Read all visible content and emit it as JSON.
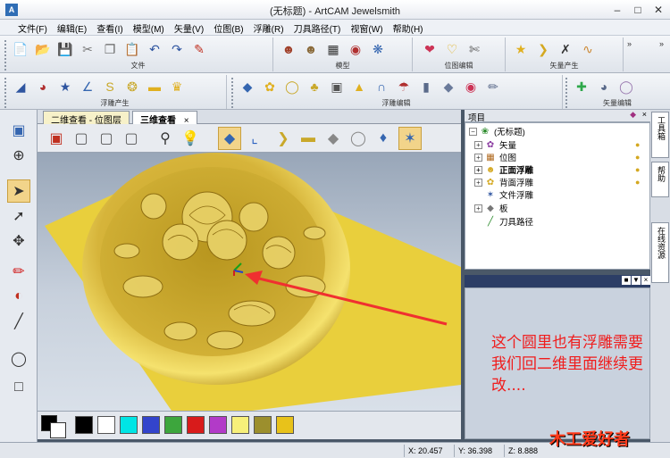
{
  "window": {
    "title": "(无标题) - ArtCAM Jewelsmith",
    "app_icon": "A"
  },
  "menu": [
    "文件(F)",
    "编辑(E)",
    "查看(I)",
    "模型(M)",
    "矢量(V)",
    "位图(B)",
    "浮雕(R)",
    "刀具路径(T)",
    "视窗(W)",
    "帮助(H)"
  ],
  "toolbar1": {
    "groups": [
      {
        "label": "文件",
        "icons": [
          "new-file-icon",
          "open-file-icon",
          "save-icon",
          "cut-icon",
          "copy-icon",
          "paste-icon",
          "undo-icon",
          "redo-icon",
          "edit-icon"
        ]
      },
      {
        "label": "模型",
        "icons": [
          "bear-model-icon",
          "bear-model-2-icon",
          "robot-model-icon",
          "disc-model-icon",
          "globe-model-icon"
        ]
      },
      {
        "label": "位图编辑",
        "icons": [
          "heart-bitmap-icon",
          "heart-outline-icon",
          "scissors-bitmap-icon"
        ]
      },
      {
        "label": "矢量产生",
        "icons": [
          "star-vector-icon",
          "chevron-vector-icon",
          "cross-vector-icon",
          "curve-vector-icon"
        ]
      },
      {
        "label": "",
        "icons": []
      }
    ]
  },
  "toolbar2": {
    "groups": [
      {
        "label": "浮雕产生",
        "icons": [
          "shape-relief-icon",
          "dome-relief-icon",
          "star-relief-icon",
          "angle-relief-icon",
          "s-curve-icon",
          "knot-relief-icon",
          "slab-relief-icon",
          "crown-relief-icon"
        ]
      },
      {
        "label": "浮雕编辑",
        "icons": [
          "diamond-edit-icon",
          "flower-edit-icon",
          "ring-edit-icon",
          "clover-edit-icon",
          "erase-edit-icon",
          "stamp-edit-icon",
          "arch-edit-icon",
          "mushroom-edit-icon",
          "column-edit-icon",
          "cube-edit-icon",
          "palette-edit-icon",
          "brush-edit-icon"
        ]
      },
      {
        "label": "矢量编辑",
        "icons": [
          "plus-vector-icon",
          "bowl-vector-icon",
          "ring-vector-icon"
        ]
      }
    ]
  },
  "tabs": [
    {
      "label": "二维查看 - 位图层"
    },
    {
      "label": "三维查看"
    }
  ],
  "project": {
    "header": "项目",
    "root": "(无标题)",
    "items": [
      {
        "label": "矢量",
        "expandable": true,
        "icon": "vector-layer-icon"
      },
      {
        "label": "位图",
        "expandable": true,
        "icon": "bitmap-layer-icon"
      },
      {
        "label": "正面浮雕",
        "expandable": true,
        "icon": "front-relief-icon",
        "bold": true
      },
      {
        "label": "背面浮雕",
        "expandable": true,
        "icon": "back-relief-icon"
      },
      {
        "label": "文件浮雕",
        "expandable": false,
        "icon": "file-relief-icon"
      },
      {
        "label": "板",
        "expandable": true,
        "icon": "board-icon"
      },
      {
        "label": "刀具路径",
        "expandable": false,
        "icon": "toolpath-icon"
      }
    ]
  },
  "right_tabs": [
    "工具箱",
    "帮助",
    "在线资源"
  ],
  "palette": {
    "colors": [
      "#000000",
      "#ffffff",
      "#00e5e5",
      "#3344cc",
      "#3da63d",
      "#d81b1b",
      "#b23ac8",
      "#f7f07a",
      "#9c8f2d",
      "#e8c21a"
    ]
  },
  "status": {
    "x": "X: 20.457",
    "y": "Y: 36.398",
    "z": "Z: 8.888"
  },
  "annotation": "这个圆里也有浮雕需要我们回二维里面继续更改....",
  "watermark": "木工爱好者"
}
